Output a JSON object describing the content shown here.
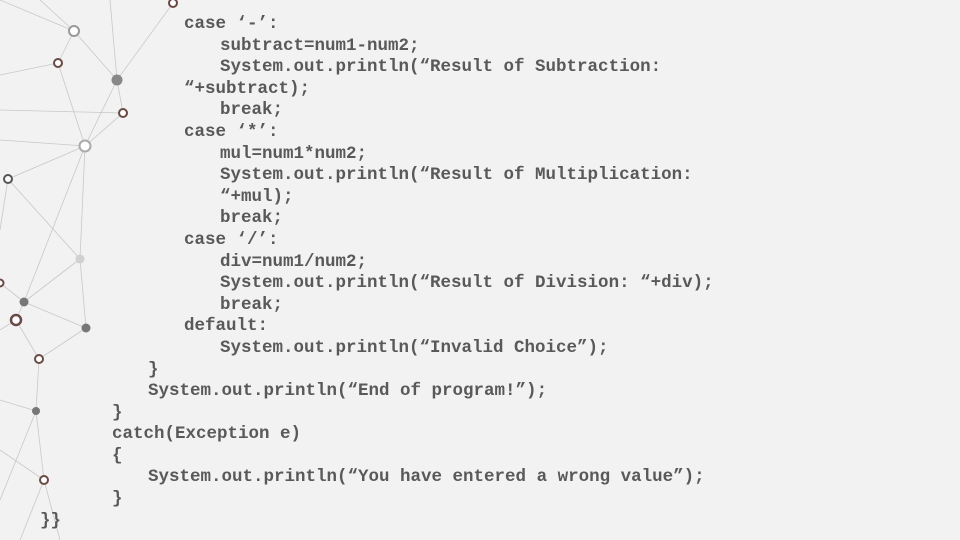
{
  "slide": {
    "code_lines": [
      {
        "text": "case ‘-’:",
        "indent": 4
      },
      {
        "text": "subtract=num1-num2;",
        "indent": 5
      },
      {
        "text": "System.out.println(“Result of Subtraction:",
        "indent": 5
      },
      {
        "text": "“+subtract);",
        "indent": 4
      },
      {
        "text": "break;",
        "indent": 5
      },
      {
        "text": "case ‘*’:",
        "indent": 4
      },
      {
        "text": "mul=num1*num2;",
        "indent": 5
      },
      {
        "text": "System.out.println(“Result of Multiplication:",
        "indent": 5
      },
      {
        "text": "“+mul);",
        "indent": 5
      },
      {
        "text": "break;",
        "indent": 5
      },
      {
        "text": "case ‘/’:",
        "indent": 4
      },
      {
        "text": "div=num1/num2;",
        "indent": 5
      },
      {
        "text": "System.out.println(“Result of Division: “+div);",
        "indent": 5
      },
      {
        "text": "break;",
        "indent": 5
      },
      {
        "text": "default:",
        "indent": 4
      },
      {
        "text": "System.out.println(“Invalid Choice”);",
        "indent": 5
      },
      {
        "text": "}",
        "indent": 3
      },
      {
        "text": "System.out.println(“End of program!”);",
        "indent": 3
      },
      {
        "text": "}",
        "indent": 2
      },
      {
        "text": "catch(Exception e)",
        "indent": 2
      },
      {
        "text": "{",
        "indent": 2
      },
      {
        "text": "System.out.println(“You have entered a wrong value”);",
        "indent": 3
      },
      {
        "text": "}",
        "indent": 2
      },
      {
        "text": "}}",
        "indent": 0
      }
    ]
  },
  "colors": {
    "background": "#f2f2f2",
    "code_text": "#595959",
    "network_lines": "#c8c8c8",
    "node_fill": "#777777"
  }
}
